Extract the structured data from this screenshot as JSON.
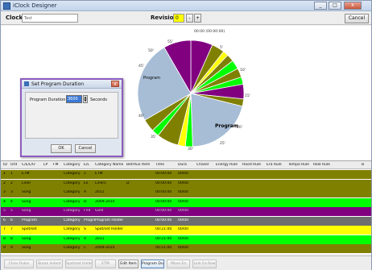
{
  "window": {
    "title": "iClock Designer",
    "minimize": "_",
    "maximize": "□",
    "close": "x"
  },
  "toolbar": {
    "clock_label": "Clock",
    "clock_value": "Test",
    "revision_label": "Revision",
    "revision_value": "0",
    "rev_minus": "-",
    "rev_plus": "+",
    "cancel_label": "Cancel"
  },
  "pie": {
    "top_label": "00:00 (00:00:00)",
    "segment_labels": {
      "program_left": "Program",
      "program_right": "Program",
      "m_55": "55'",
      "m_50": "50'",
      "m_45": "45'",
      "m_40": "40'",
      "m_35": "35'",
      "m_30": "30'",
      "m_25": "25'",
      "m_20": "20'",
      "m_15": "15'",
      "m_10": "10'",
      "m_5": "5'"
    },
    "slices": [
      {
        "label": "purple",
        "color": "#800080",
        "start": 0,
        "end": 24
      },
      {
        "label": "olive",
        "color": "#808000",
        "start": 24,
        "end": 38
      },
      {
        "label": "yellow",
        "color": "#ffff00",
        "start": 38,
        "end": 44
      },
      {
        "label": "olive",
        "color": "#808000",
        "start": 44,
        "end": 52
      },
      {
        "label": "lime",
        "color": "#00ff00",
        "start": 52,
        "end": 62
      },
      {
        "label": "olive",
        "color": "#808000",
        "start": 62,
        "end": 72
      },
      {
        "label": "lime",
        "color": "#00ff00",
        "start": 72,
        "end": 80
      },
      {
        "label": "purple",
        "color": "#800080",
        "start": 80,
        "end": 96
      },
      {
        "label": "olive",
        "color": "#808000",
        "start": 96,
        "end": 104
      },
      {
        "label": "program",
        "color": "#a7bdd6",
        "start": 104,
        "end": 178
      },
      {
        "label": "lime",
        "color": "#00ff00",
        "start": 178,
        "end": 186
      },
      {
        "label": "yellow",
        "color": "#ffff00",
        "start": 186,
        "end": 194
      },
      {
        "label": "olive",
        "color": "#808000",
        "start": 194,
        "end": 218
      },
      {
        "label": "lime",
        "color": "#00ff00",
        "start": 218,
        "end": 226
      },
      {
        "label": "olive",
        "color": "#808000",
        "start": 226,
        "end": 240
      },
      {
        "label": "program",
        "color": "#a7bdd6",
        "start": 240,
        "end": 330
      },
      {
        "label": "purple",
        "color": "#800080",
        "start": 330,
        "end": 360
      }
    ]
  },
  "dialog": {
    "title": "Set Program Duration",
    "close": "x",
    "field_label": "Program Duration:",
    "field_value": "3600",
    "unit": "Seconds",
    "ok_label": "OK",
    "cancel_label": "Cancel"
  },
  "grid": {
    "headers": [
      "ID",
      "Ord",
      "C/E/L/O",
      "LP",
      "FM",
      "Category",
      "E/L",
      "Category Name",
      "Bef/Aux",
      "Item",
      "Time",
      "Dura",
      "Chaser",
      "Energy Rule",
      "Hood Rule",
      "Era Rule",
      "Tempo Rule",
      "Role Rule",
      "B"
    ],
    "rows": [
      {
        "bg": "#808000",
        "fg": "#000000",
        "cells": [
          "1",
          "1",
          "ETM",
          "",
          "",
          "Category",
          "v",
          "ETM",
          "",
          "",
          "00:00:00",
          "00/00"
        ]
      },
      {
        "bg": "#808000",
        "fg": "#000000",
        "cells": [
          "2",
          "2",
          "Liner",
          "",
          "",
          "Category",
          "Ex",
          "Liners",
          "D",
          "",
          "00:00:00",
          "00/00"
        ]
      },
      {
        "bg": "#808000",
        "fg": "#000000",
        "cells": [
          "3",
          "3",
          "Song",
          "",
          "",
          "Category",
          "A",
          "2011",
          "",
          "",
          "00:00:00",
          "00/00"
        ]
      },
      {
        "bg": "#00ff00",
        "fg": "#000000",
        "cells": [
          "4",
          "4",
          "Song",
          "",
          "",
          "Category",
          "D",
          "2009-2010",
          "",
          "",
          "00:00:00",
          "00/00"
        ]
      },
      {
        "bg": "#800080",
        "fg": "#cccccc",
        "cells": [
          "5",
          "5",
          "Song",
          "",
          "",
          "Category",
          "Fnd",
          "Gold",
          "",
          "",
          "00:00:00",
          "00/00"
        ]
      },
      {
        "bg": "#6e6e6e",
        "fg": "#ffffff",
        "cells": [
          "6",
          "6",
          "Program",
          "",
          "",
          "Category",
          "Program",
          "Program Holder",
          "",
          "",
          "00:00:00",
          "00/00"
        ]
      },
      {
        "bg": "#ffff00",
        "fg": "#000000",
        "cells": [
          "7",
          "7",
          "Spot/set",
          "",
          "",
          "Category",
          "S",
          "Spot/set Holder",
          "",
          "",
          "00:21:00",
          "00/00"
        ]
      },
      {
        "bg": "#00ff00",
        "fg": "#000000",
        "cells": [
          "8",
          "8",
          "Song",
          "",
          "",
          "Category",
          "A",
          "2011",
          "",
          "",
          "00:21:00",
          "00/00"
        ]
      },
      {
        "bg": "#808000",
        "fg": "#000000",
        "cells": [
          "9",
          "9",
          "Song",
          "",
          "",
          "Category",
          "C",
          "2009-2010",
          "",
          "",
          "00:21:00",
          "00/00"
        ]
      }
    ]
  },
  "bottombar": {
    "buttons": [
      {
        "label": "Clear Rules",
        "state": "disabled"
      },
      {
        "label": "Break Indent",
        "state": "disabled"
      },
      {
        "label": "Spot/set Holder",
        "state": "disabled"
      },
      {
        "label": "ETM",
        "state": "disabled"
      },
      {
        "label": "Edit Item",
        "state": "normal"
      },
      {
        "label": "Program Dur",
        "state": "active"
      },
      {
        "label": "Move Ea",
        "state": "disabled"
      },
      {
        "label": "Link Ea Row",
        "state": "disabled"
      }
    ]
  }
}
